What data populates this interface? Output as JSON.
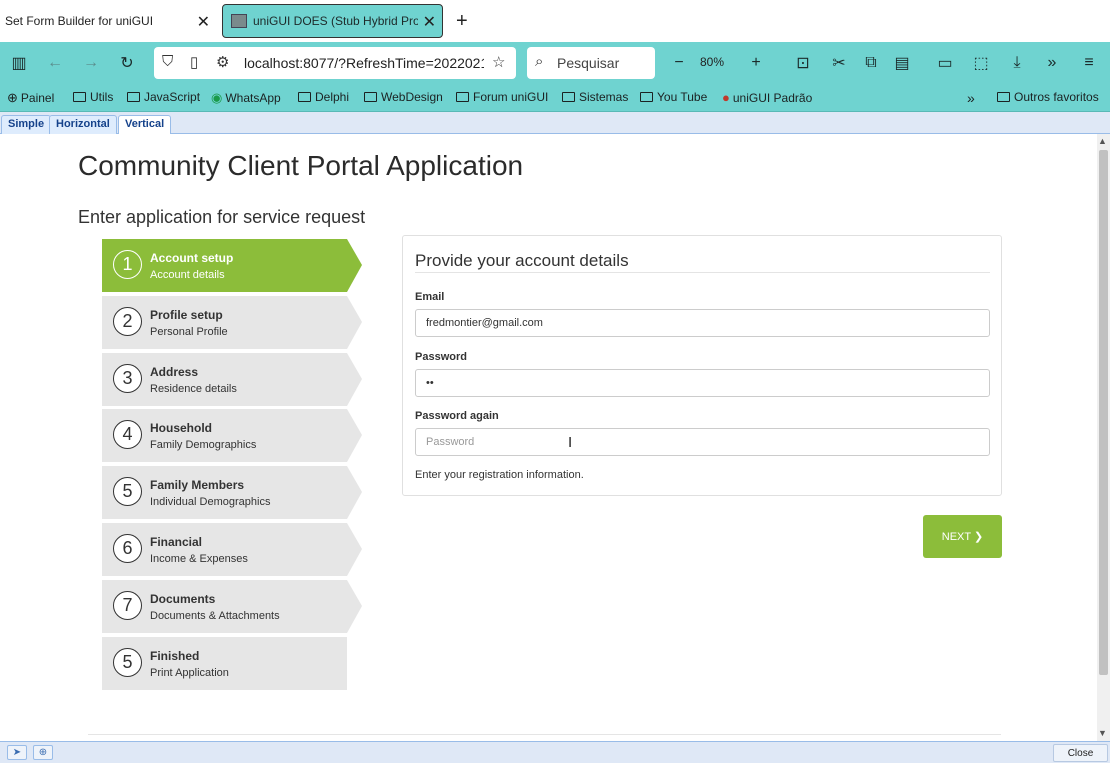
{
  "browser": {
    "tabs": [
      {
        "title": "Set Form Builder for uniGUI"
      },
      {
        "title": "uniGUI DOES (Stub Hybrid Proje"
      }
    ],
    "url": "localhost:8077/?RefreshTime=2022021",
    "search_placeholder": "Pesquisar",
    "zoom": "80%",
    "bookmarks": [
      {
        "label": "Painel",
        "icon": "globe-icon"
      },
      {
        "label": "Utils",
        "icon": "folder-icon"
      },
      {
        "label": "JavaScript",
        "icon": "folder-icon"
      },
      {
        "label": "WhatsApp",
        "icon": "whatsapp-icon"
      },
      {
        "label": "Delphi",
        "icon": "folder-icon"
      },
      {
        "label": "WebDesign",
        "icon": "folder-icon"
      },
      {
        "label": "Forum uniGUI",
        "icon": "folder-icon"
      },
      {
        "label": "Sistemas",
        "icon": "folder-icon"
      },
      {
        "label": "You Tube",
        "icon": "folder-icon"
      },
      {
        "label": "uniGUI Padrão",
        "icon": "unigui-icon"
      }
    ],
    "other_bookmarks": "Outros favoritos"
  },
  "app_tabs": [
    "Simple",
    "Horizontal",
    "Vertical"
  ],
  "page": {
    "title": "Community Client Portal Application",
    "subtitle": "Enter application for service request"
  },
  "steps": [
    {
      "num": "1",
      "title": "Account setup",
      "sub": "Account details",
      "active": true
    },
    {
      "num": "2",
      "title": "Profile setup",
      "sub": "Personal Profile"
    },
    {
      "num": "3",
      "title": "Address",
      "sub": "Residence details"
    },
    {
      "num": "4",
      "title": "Household",
      "sub": "Family Demographics"
    },
    {
      "num": "5",
      "title": "Family Members",
      "sub": "Individual Demographics"
    },
    {
      "num": "6",
      "title": "Financial",
      "sub": "Income & Expenses"
    },
    {
      "num": "7",
      "title": "Documents",
      "sub": "Documents & Attachments"
    },
    {
      "num": "5",
      "title": "Finished",
      "sub": "Print Application"
    }
  ],
  "form": {
    "title": "Provide your account details",
    "email_label": "Email",
    "email_value": "fredmontier@gmail.com",
    "password_label": "Password",
    "password_value": "••",
    "password_again_label": "Password again",
    "password_again_placeholder": "Password",
    "hint": "Enter your registration information."
  },
  "next_label": "NEXT ❯",
  "close_label": "Close",
  "colors": {
    "accent": "#8cbd3a",
    "browser": "#6fd3d0",
    "step_bg": "#e6e6e6"
  }
}
